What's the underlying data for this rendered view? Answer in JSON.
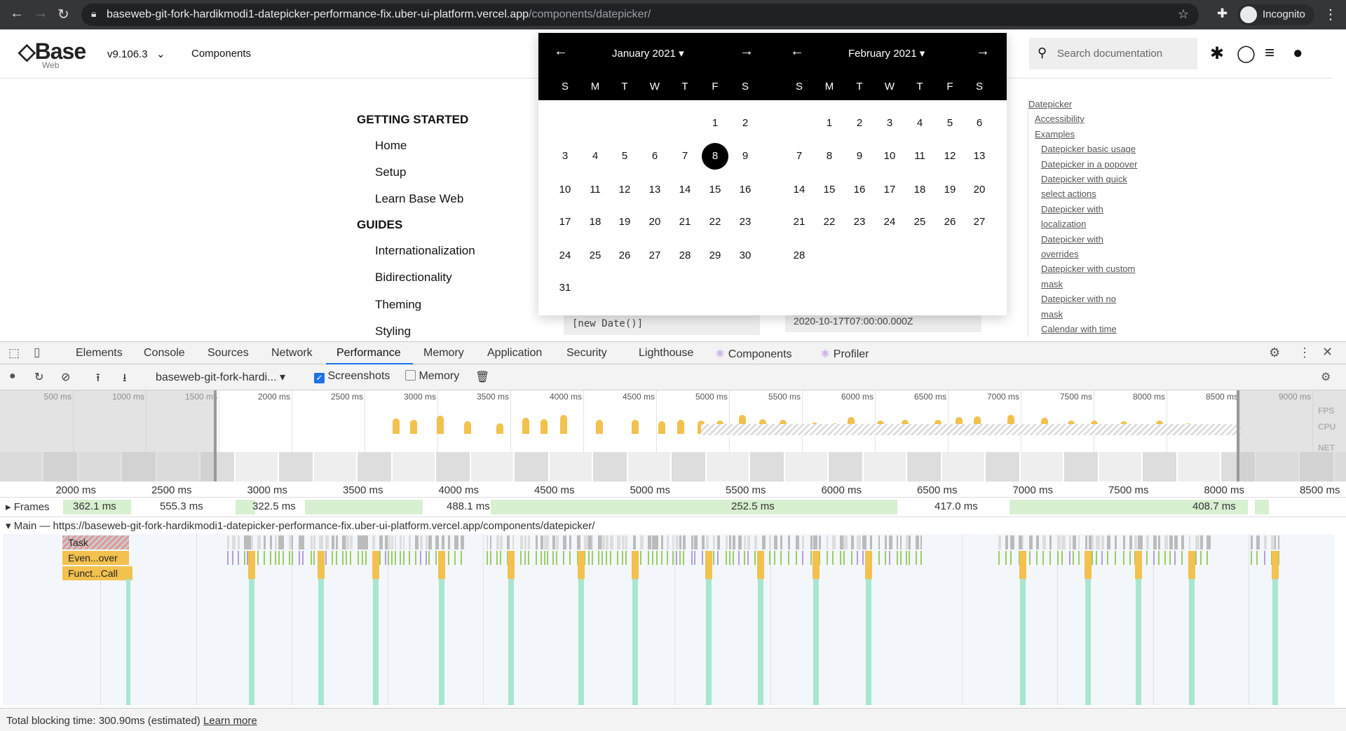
{
  "browser": {
    "url_host": "baseweb-git-fork-hardikmodi1-datepicker-performance-fix.uber-ui-platform.vercel.app",
    "url_path": "/components/datepicker/",
    "profile": "Incognito"
  },
  "site": {
    "logo": "Base",
    "logo_sub": "Web",
    "version": "v9.106.3",
    "components": "Components",
    "search_placeholder": "Search documentation"
  },
  "left_nav": [
    {
      "type": "h",
      "label": "GETTING STARTED"
    },
    {
      "type": "i",
      "label": "Home"
    },
    {
      "type": "i",
      "label": "Setup"
    },
    {
      "type": "i",
      "label": "Learn Base Web"
    },
    {
      "type": "h",
      "label": "GUIDES"
    },
    {
      "type": "i",
      "label": "Internationalization"
    },
    {
      "type": "i",
      "label": "Bidirectionality"
    },
    {
      "type": "i",
      "label": "Theming"
    },
    {
      "type": "i",
      "label": "Styling"
    }
  ],
  "toc": [
    {
      "label": "Datepicker",
      "lvl": 0
    },
    {
      "label": "Accessibility",
      "lvl": 1
    },
    {
      "label": "Examples",
      "lvl": 1
    },
    {
      "label": "Datepicker basic usage",
      "lvl": 2
    },
    {
      "label": "Datepicker in a popover",
      "lvl": 2
    },
    {
      "label": "Datepicker with quick",
      "lvl": 2
    },
    {
      "label": "select actions",
      "lvl": 2
    },
    {
      "label": "Datepicker with",
      "lvl": 2
    },
    {
      "label": "localization",
      "lvl": 2
    },
    {
      "label": "Datepicker with",
      "lvl": 2
    },
    {
      "label": "overrides",
      "lvl": 2
    },
    {
      "label": "Datepicker with custom",
      "lvl": 2
    },
    {
      "label": "mask",
      "lvl": 2
    },
    {
      "label": "Datepicker with no",
      "lvl": 2
    },
    {
      "label": "mask",
      "lvl": 2
    },
    {
      "label": "Calendar with time",
      "lvl": 2
    }
  ],
  "calendar": {
    "weekdays": [
      "S",
      "M",
      "T",
      "W",
      "T",
      "F",
      "S"
    ],
    "selected_day": 8,
    "months": [
      {
        "title": "January 2021",
        "start": 5,
        "days": 31
      },
      {
        "title": "February 2021",
        "start": 1,
        "days": 28
      }
    ]
  },
  "code": {
    "left": "[new Date()]",
    "right": "2020-10-17T07:00:00.000Z"
  },
  "devtools": {
    "tabs": [
      "Elements",
      "Console",
      "Sources",
      "Network",
      "Performance",
      "Memory",
      "Application",
      "Security",
      "Lighthouse",
      "Components",
      "Profiler"
    ],
    "active_tab": "Performance",
    "profile_select": "baseweb-git-fork-hardi...",
    "screenshots_label": "Screenshots",
    "screenshots_checked": true,
    "memory_label": "Memory",
    "memory_checked": false,
    "overview_ticks": [
      "500 ms",
      "1000 ms",
      "1500 ms",
      "2000 ms",
      "2500 ms",
      "3000 ms",
      "3500 ms",
      "4000 ms",
      "4500 ms",
      "5000 ms",
      "5500 ms",
      "6000 ms",
      "6500 ms",
      "7000 ms",
      "7500 ms",
      "8000 ms",
      "8500 ms",
      "9000 ms"
    ],
    "overview_labels": [
      "FPS",
      "CPU",
      "NET"
    ],
    "ruler_ticks": [
      "2000 ms",
      "2500 ms",
      "3000 ms",
      "3500 ms",
      "4000 ms",
      "4500 ms",
      "5000 ms",
      "5500 ms",
      "6000 ms",
      "6500 ms",
      "7000 ms",
      "7500 ms",
      "8000 ms",
      "8500 ms"
    ],
    "frames_label": "Frames",
    "frames": [
      "362.1 ms",
      "555.3 ms",
      "322.5 ms",
      "488.1 ms",
      "252.5 ms",
      "417.0 ms",
      "408.7 ms"
    ],
    "main_label": "Main — https://baseweb-git-fork-hardikmodi1-datepicker-performance-fix.uber-ui-platform.vercel.app/components/datepicker/",
    "flame_labels": [
      "Task",
      "Even...over",
      "Funct...Call"
    ],
    "status_text": "Total blocking time: 300.90ms (estimated)",
    "learn_more": "Learn more"
  },
  "colors": {
    "task": "#c8c8c8",
    "event": "#f2c14e",
    "function": "#f2c14e",
    "frames": "#d7f0d0",
    "paint": "#a8e6cf",
    "accent": "#1a73e8"
  }
}
